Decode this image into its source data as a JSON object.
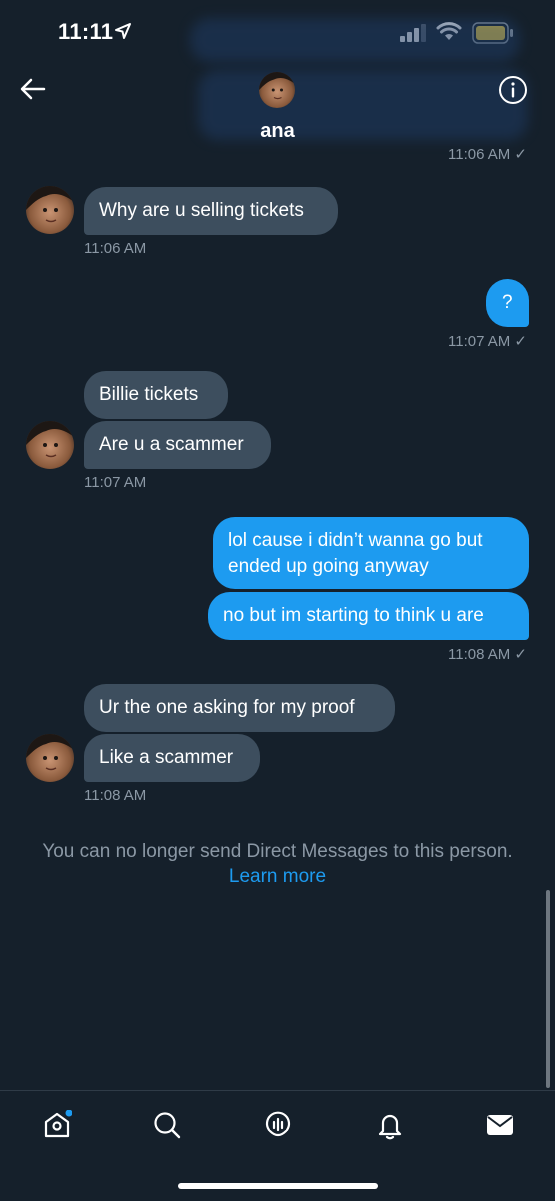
{
  "status_bar": {
    "time": "11:11"
  },
  "header": {
    "name": "ana",
    "prev_time": "11:06 AM ✓"
  },
  "messages": {
    "m1": "Why are u selling tickets",
    "t1": "11:06 AM",
    "m2": "?",
    "t2": "11:07 AM ✓",
    "m3": "Billie tickets",
    "m4": "Are u a scammer",
    "t3": "11:07 AM",
    "m5_line1": "lol cause i didn’t wanna go but",
    "m5_line2": "ended up going anyway",
    "m6": "no but im starting to think u are",
    "t4": "11:08 AM ✓",
    "m7": "Ur the one asking for my proof",
    "m8": "Like a scammer",
    "t5": "11:08 AM"
  },
  "notice": {
    "text": "You can no longer send Direct Messages to this person.",
    "link": "Learn more"
  },
  "tabbar": {
    "items": [
      "home-icon",
      "search-icon",
      "spaces-icon",
      "notifications-icon",
      "messages-icon"
    ]
  },
  "colors": {
    "background": "#15202b",
    "incoming": "#3d4e5e",
    "outgoing": "#1d9bf0",
    "muted": "#8b98a5"
  }
}
